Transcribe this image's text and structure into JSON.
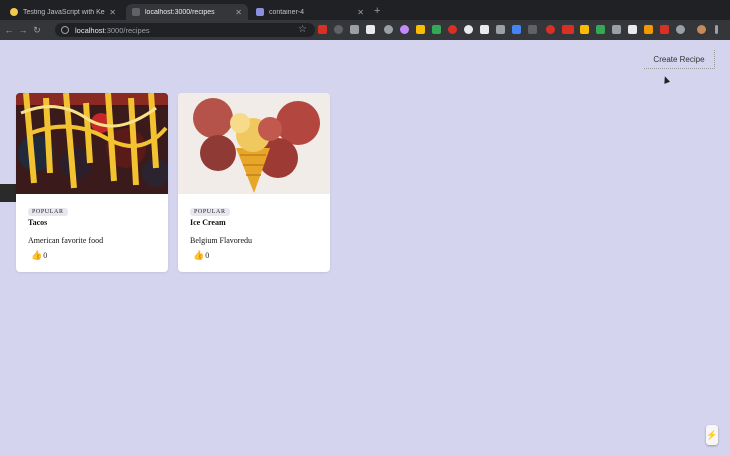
{
  "browser": {
    "tabs": [
      {
        "title": "Testing JavaScript with Kent",
        "active": false,
        "color": "#f2c94c"
      },
      {
        "title": "localhost:3000/recipes",
        "active": true,
        "color": "#5f6368"
      },
      {
        "title": "container-4",
        "active": false,
        "color": "#8a8fe0"
      }
    ],
    "new_tab": "+",
    "url_host": "localhost",
    "url_path": ":3000/recipes"
  },
  "page": {
    "create_button": "Create Recipe",
    "cards": [
      {
        "badge": "POPULAR",
        "name": "Tacos",
        "description": "American favorite food",
        "likes": "0"
      },
      {
        "badge": "POPULAR",
        "name": "Ice Cream",
        "description": "Belgium Flavoredu",
        "likes": "0"
      }
    ]
  },
  "colors": {
    "page_bg": "#d4d4ee",
    "chrome_bg": "#202124",
    "toolbar_bg": "#35363a"
  }
}
